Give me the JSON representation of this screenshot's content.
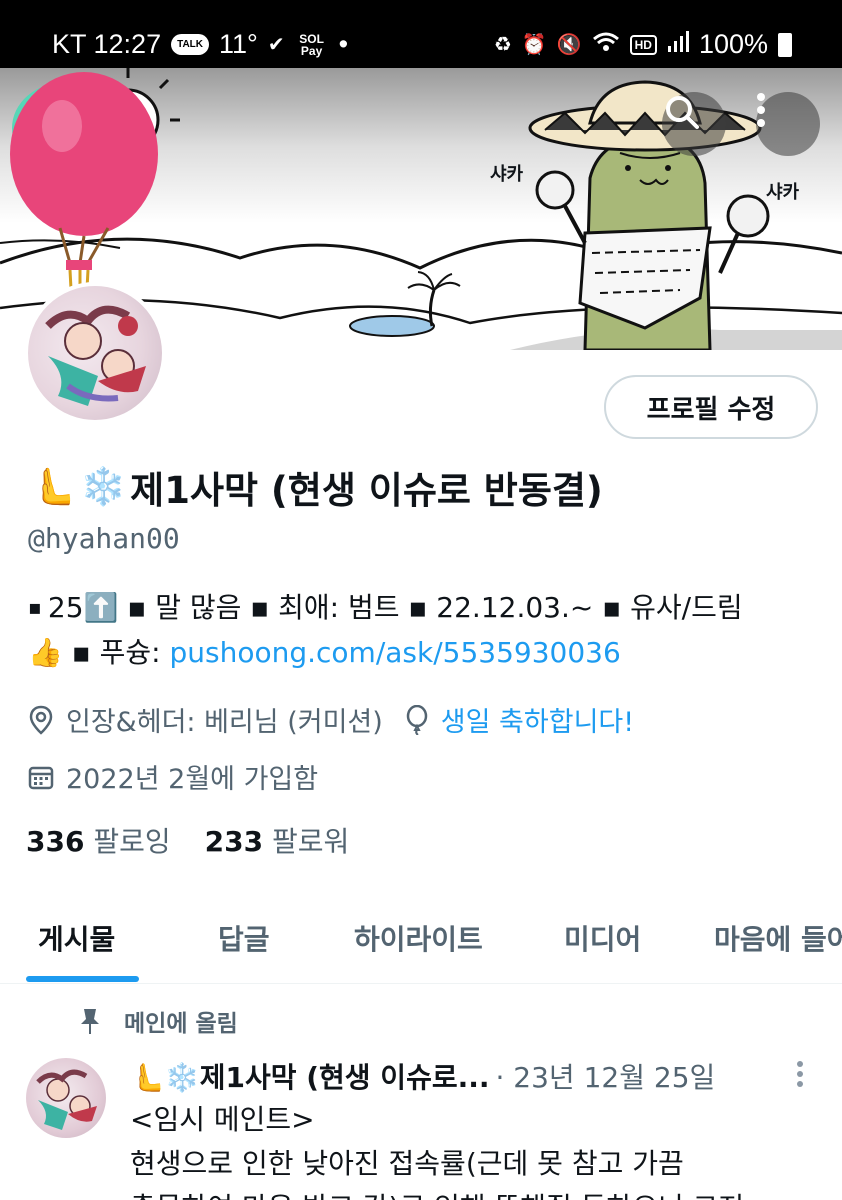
{
  "status_bar": {
    "carrier_time": "KT 12:27",
    "talk_badge": "TALK",
    "temperature": "11°",
    "sol_pay": "SOL Pay",
    "dot": "•",
    "battery": "100%"
  },
  "banner": {
    "sound_left": "샤카",
    "sound_right": "샤카"
  },
  "toolbar": {
    "search_icon": "search-icon",
    "more_icon": "more-vertical-icon"
  },
  "profile": {
    "edit_button": "프로필 수정",
    "name": "제1사막 (현생 이슈로 반동결)",
    "name_emoji_hand": "🫷",
    "name_emoji_snow": "❄️",
    "handle": "@hyahan00",
    "bio_line1": "25⬆️ ▪ 말 많음 ▪ 최애: 범트 ▪ 22.12.03.~ ▪ 유사/드림",
    "bio_line1_prefix": "▪ ",
    "bio_line2_prefix": "👍 ▪ 푸슝: ",
    "bio_link": "pushoong.com/ask/5535930036",
    "location": "인장&헤더: 베리님 (커미션)",
    "birthday": "생일 축하합니다!",
    "joined": "2022년 2월에 가입함",
    "following_count": "336",
    "following_label": "팔로잉",
    "followers_count": "233",
    "followers_label": "팔로워"
  },
  "tabs": [
    {
      "label": "게시물",
      "active": true
    },
    {
      "label": "답글",
      "active": false
    },
    {
      "label": "하이라이트",
      "active": false
    },
    {
      "label": "미디어",
      "active": false
    },
    {
      "label": "마음에 들어",
      "active": false
    }
  ],
  "pinned": {
    "label": "메인에 올림"
  },
  "post": {
    "author": "🫷❄️제1사막 (현생 이슈로...",
    "date": "· 23년 12월 25일",
    "lines": [
      "<임시 메인트>",
      "현생으로 인한 낮아진 접속률(근데 못 참고 가끔",
      "출몰하여 마음 받고 감)로 인해 뜸해질 듯하오니 그저"
    ]
  },
  "colors": {
    "accent": "#1d9bf0",
    "secondary_text": "#536471",
    "border": "#cfd9de"
  }
}
